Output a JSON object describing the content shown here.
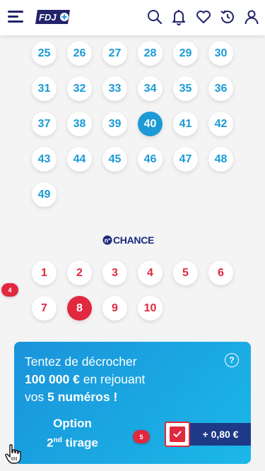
{
  "header": {
    "menu_icon": "hamburger-menu-icon",
    "logo_text": "FDJ",
    "icons": [
      "search-icon",
      "bell-icon",
      "heart-icon",
      "history-icon",
      "user-icon"
    ]
  },
  "main_numbers": {
    "numbers": [
      "25",
      "26",
      "27",
      "28",
      "29",
      "30",
      "31",
      "32",
      "33",
      "34",
      "35",
      "36",
      "37",
      "38",
      "39",
      "40",
      "41",
      "42",
      "43",
      "44",
      "45",
      "46",
      "47",
      "48",
      "49"
    ],
    "selected": [
      "40"
    ]
  },
  "chance": {
    "logo_text": "CHANCE",
    "numbers": [
      "1",
      "2",
      "3",
      "4",
      "5",
      "6",
      "7",
      "8",
      "9",
      "10"
    ],
    "selected": [
      "8"
    ]
  },
  "markers": {
    "m4": "4",
    "m5": "5"
  },
  "promo": {
    "line1": "Tentez de décrocher",
    "amount": "100 000 €",
    "line2_rest": " en rejouant",
    "line3_pre": "vos ",
    "line3_bold": "5 numéros !",
    "help": "?",
    "option_line1": "Option",
    "option_num": "2",
    "option_sup": "nd",
    "option_rest": " tirage",
    "option_checked": true,
    "price": "+ 0,80 €"
  },
  "colors": {
    "navy": "#22236b",
    "blue": "#1b9ad6",
    "red": "#e0283e",
    "price_bg": "#1e3a87"
  }
}
